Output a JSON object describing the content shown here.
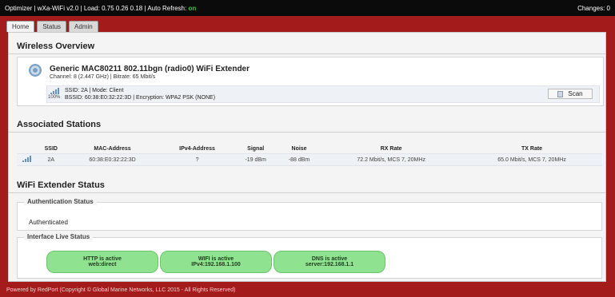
{
  "topbar": {
    "left_text": "Optimizer | wXa-WiFi v2.0 | Load: 0.75 0.26 0.18 | Auto Refresh:",
    "auto_refresh": "on",
    "changes": "Changes: 0"
  },
  "tabs": [
    "Home",
    "Status",
    "Admin"
  ],
  "overview": {
    "title": "Wireless Overview",
    "device_name": "Generic MAC80211 802.11bgn (radio0) WiFi Extender",
    "device_sub": "Channel: 8 (2.447 GHz) | Bitrate: 65 Mbit/s",
    "signal_pct": "100%",
    "ssid_line": "SSID: 2A | Mode: Client",
    "bssid_line": "BSSID: 60:38:E0:32:22:3D | Encryption: WPA2 PSK (NONE)",
    "scan_label": "Scan"
  },
  "stations": {
    "title": "Associated Stations",
    "headers": [
      "SSID",
      "MAC-Address",
      "IPv4-Address",
      "Signal",
      "Noise",
      "RX Rate",
      "TX Rate"
    ],
    "rows": [
      [
        "2A",
        "60:38:E0:32:22:3D",
        "?",
        "-19 dBm",
        "-88 dBm",
        "72.2 Mbit/s, MCS 7, 20MHz",
        "65.0 Mbit/s, MCS 7, 20MHz"
      ]
    ]
  },
  "extender": {
    "title": "WiFi Extender Status",
    "auth_legend": "Authentication Status",
    "auth_value": "Authenticated",
    "iface_legend": "Interface Live Status",
    "pills": [
      {
        "line1": "HTTP is active",
        "line2": "web:direct"
      },
      {
        "line1": "WIFI is active",
        "line2": "IPv4:192.168.1.100"
      },
      {
        "line1": "DNS is active",
        "line2": "server:192.168.1.1"
      }
    ]
  },
  "footer": "Powered by RedPort (Copyright © Global Marine Networks, LLC 2015 - All Rights Reserved)",
  "colors": {
    "brand_red": "#a41b1b",
    "status_green": "#8fe28f",
    "topbar": "#0b0b0b"
  }
}
